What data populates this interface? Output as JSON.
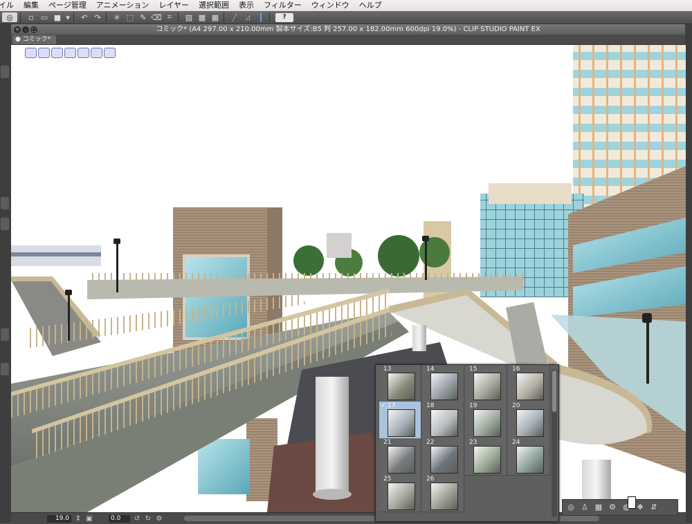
{
  "menubar": {
    "items": [
      "イル",
      "編集",
      "ページ管理",
      "アニメーション",
      "レイヤー",
      "選択範囲",
      "表示",
      "フィルター",
      "ウィンドウ",
      "ヘルプ"
    ]
  },
  "toolbar": {
    "icons": [
      "clip-logo-icon",
      "new-file-icon",
      "open-file-icon",
      "save-icon",
      "save-dropdown-icon",
      "undo-icon",
      "redo-icon",
      "transform-icon",
      "select-all-icon",
      "brush-icon",
      "eraser-icon",
      "crop-icon",
      "fill-icon",
      "snap-ruler-icon",
      "snap-grid-icon",
      "snap-line-icon",
      "snap-special-icon",
      "help-icon"
    ],
    "help_label": "?"
  },
  "window": {
    "title": "コミック* (A4 297.00 x 210.00mm 製本サイズ:B5 判 257.00 x 182.00mm 600dpi 19.0%)  - CLIP STUDIO PAINT EX"
  },
  "document_tab": {
    "label": "コミック*"
  },
  "navigator_icons": [
    "rotate-left-icon",
    "rotate-right-icon",
    "flip-icon",
    "fit-icon",
    "zoom-in-icon",
    "zoom-out-icon",
    "reset-icon"
  ],
  "statusbar": {
    "zoom": "19.0",
    "angle": "0.0"
  },
  "page_panel": {
    "selected_page": "17",
    "pages": [
      {
        "num": "13",
        "tone": "#8a8a7a"
      },
      {
        "num": "14",
        "tone": "#9aa0a8"
      },
      {
        "num": "15",
        "tone": "#a8a89c"
      },
      {
        "num": "16",
        "tone": "#b4b0a4"
      },
      {
        "num": "17",
        "tone": "#a8b4bc"
      },
      {
        "num": "18",
        "tone": "#b8bcc0"
      },
      {
        "num": "19",
        "tone": "#a0aca0"
      },
      {
        "num": "20",
        "tone": "#a8b0b8"
      },
      {
        "num": "21",
        "tone": "#787c80"
      },
      {
        "num": "22",
        "tone": "#6c747c"
      },
      {
        "num": "23",
        "tone": "#9cac98"
      },
      {
        "num": "24",
        "tone": "#90a4a0"
      },
      {
        "num": "25",
        "tone": "#a4a89c"
      },
      {
        "num": "26",
        "tone": "#9ca094"
      }
    ]
  },
  "colors": {
    "sky": "#ffffff",
    "bridge_deck": "#8c9088",
    "railing": "#c8b896",
    "building_brick": "#a89480",
    "glass": "#8cc8d0"
  }
}
